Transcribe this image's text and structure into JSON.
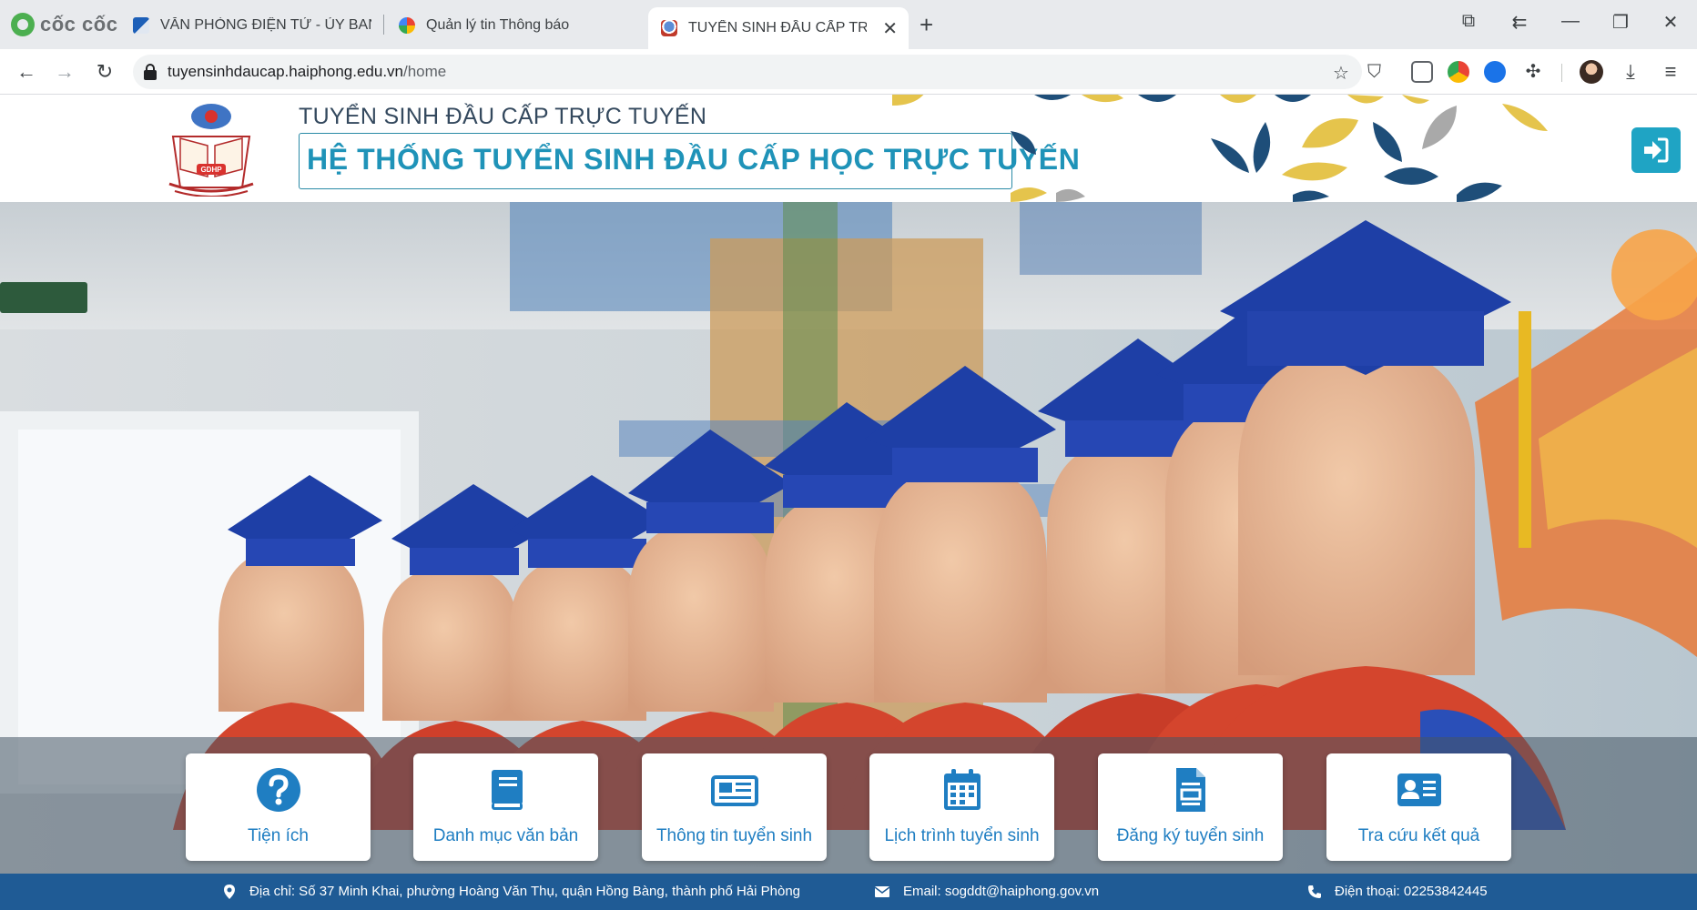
{
  "browser": {
    "brand": "cốc cốc",
    "tabs": [
      {
        "title": "VĂN PHÒNG ĐIỆN TỬ - ỦY BAN N",
        "favicon": "office-favicon"
      },
      {
        "title": "Quản lý tin Thông báo",
        "favicon": "colorful-favicon"
      },
      {
        "title": "TUYỂN SINH ĐẦU CẤP TRỰC",
        "favicon": "gdhp-favicon",
        "active": true
      }
    ],
    "new_tab_icon": "plus-icon",
    "url_host": "tuyensinhdaucap.haiphong.edu.vn",
    "url_path": "/home"
  },
  "header": {
    "logo_text": "GDHP",
    "subtitle": "TUYỂN SINH ĐẦU CẤP TRỰC TUYẾN",
    "title": "HỆ THỐNG TUYỂN SINH ĐẦU CẤP HỌC TRỰC TUYẾN",
    "login_icon": "sign-in-icon"
  },
  "quick_links": [
    {
      "label": "Tiện ích",
      "icon": "question-circle-icon"
    },
    {
      "label": "Danh mục văn bản",
      "icon": "book-icon"
    },
    {
      "label": "Thông tin tuyển sinh",
      "icon": "newspaper-icon"
    },
    {
      "label": "Lịch trình tuyển sinh",
      "icon": "calendar-icon"
    },
    {
      "label": "Đăng ký tuyển sinh",
      "icon": "file-form-icon"
    },
    {
      "label": "Tra cứu kết quả",
      "icon": "id-card-icon"
    }
  ],
  "footer": {
    "address": "Địa chỉ: Số 37 Minh Khai, phường Hoàng Văn Thụ, quận Hồng Bàng, thành phố Hải Phòng",
    "email": "Email: sogddt@haiphong.gov.vn",
    "phone": "Điện thoại: 02253842445"
  },
  "colors": {
    "accent": "#1f93b8",
    "footer": "#1f5b95",
    "quick_link_text": "#1f7ec2"
  }
}
